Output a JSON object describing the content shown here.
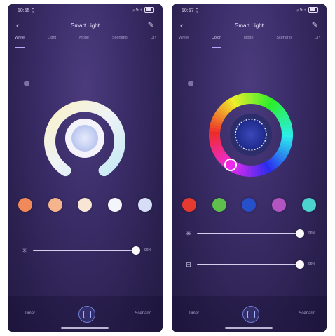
{
  "left": {
    "status": {
      "time": "10:55 ⚲",
      "signal": "ᵢₗ 5G"
    },
    "nav": {
      "title": "Smart Light"
    },
    "tabs": [
      "White",
      "Light",
      "Mode",
      "Scenario",
      "DIY"
    ],
    "active_tab": 0,
    "swatches": [
      "#f08a5b",
      "#f5b48c",
      "#f7e6d3",
      "#f4f4fb",
      "#d6ddf7"
    ],
    "slider": {
      "value": "96%",
      "level": 0.96
    },
    "bottom": {
      "left": "Timer",
      "right": "Scenario"
    }
  },
  "right": {
    "status": {
      "time": "10:57 ⚲",
      "signal": "ᵢₗ 5G"
    },
    "nav": {
      "title": "Smart Light"
    },
    "tabs": [
      "White",
      "Color",
      "Mode",
      "Scenario",
      "DIY"
    ],
    "active_tab": 1,
    "swatches": [
      "#e53a2f",
      "#5fbf4c",
      "#2650c9",
      "#b255c2",
      "#4cd3d0"
    ],
    "sliders": [
      {
        "value": "96%",
        "level": 0.96
      },
      {
        "value": "96%",
        "level": 0.96
      }
    ],
    "bottom": {
      "left": "Timer",
      "right": "Scenario"
    }
  },
  "colors": {
    "background": "#2f2458",
    "accent": "#6f7ed6"
  },
  "icons": {
    "back": "chevron-left-icon",
    "edit": "pencil-icon",
    "power": "power-icon",
    "brightness": "sun-icon",
    "saturation": "palette-icon"
  }
}
